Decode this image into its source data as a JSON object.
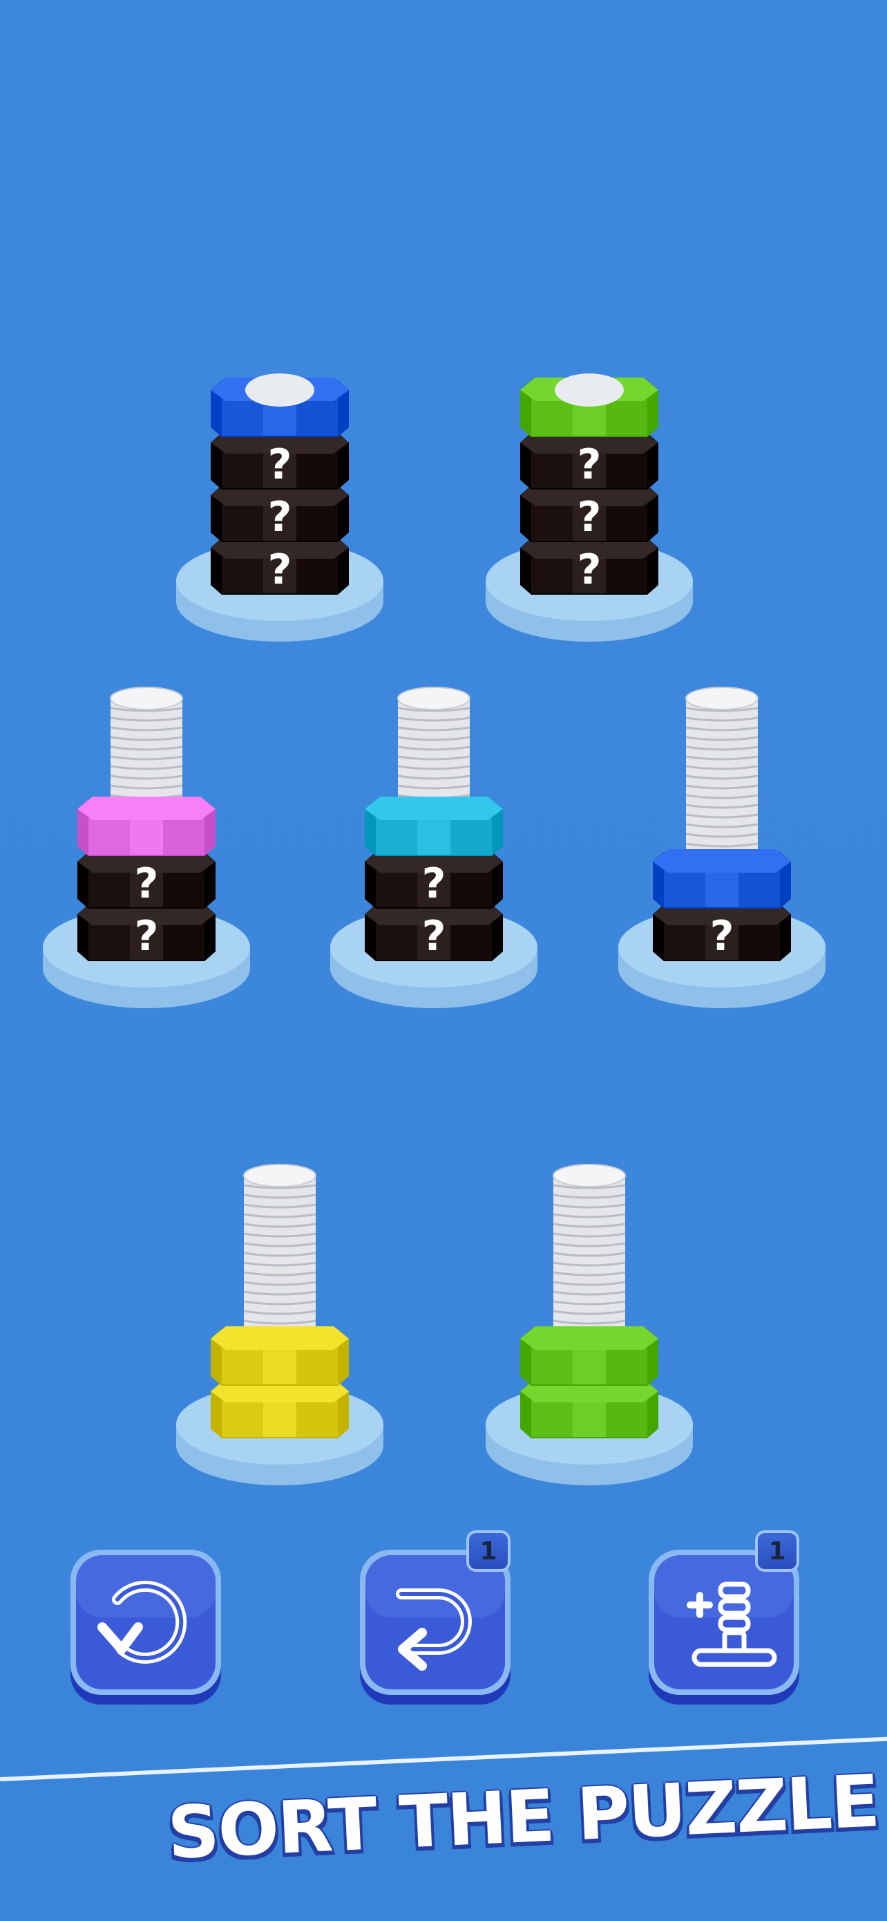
{
  "colors": {
    "background": "#3d87dc",
    "blue": "#1f5ee0",
    "green": "#62c51c",
    "pink": "#e56ee6",
    "cyan": "#21b5d9",
    "yellow": "#e0d21a",
    "hidden": "#221615",
    "base": "#a9d3f3"
  },
  "pegs": [
    {
      "id": "peg-1",
      "nuts": [
        "hidden",
        "hidden",
        "hidden",
        "blue"
      ],
      "top_open": false
    },
    {
      "id": "peg-2",
      "nuts": [
        "hidden",
        "hidden",
        "hidden",
        "green"
      ],
      "top_open": false
    },
    {
      "id": "peg-3",
      "nuts": [
        "hidden",
        "hidden",
        "pink"
      ],
      "top_open": true
    },
    {
      "id": "peg-4",
      "nuts": [
        "hidden",
        "hidden",
        "cyan"
      ],
      "top_open": true
    },
    {
      "id": "peg-5",
      "nuts": [
        "hidden",
        "blue"
      ],
      "top_open": true
    },
    {
      "id": "peg-6",
      "nuts": [
        "yellow",
        "yellow"
      ],
      "top_open": true
    },
    {
      "id": "peg-7",
      "nuts": [
        "green",
        "green"
      ],
      "top_open": true
    }
  ],
  "hidden_mark": "?",
  "buttons": {
    "restart": {
      "icon": "restart-icon"
    },
    "undo": {
      "icon": "undo-icon",
      "badge": "1"
    },
    "add_bolt": {
      "icon": "add-bolt-icon",
      "badge": "1"
    }
  },
  "banner": {
    "text": "SORT THE PUZZLE"
  }
}
